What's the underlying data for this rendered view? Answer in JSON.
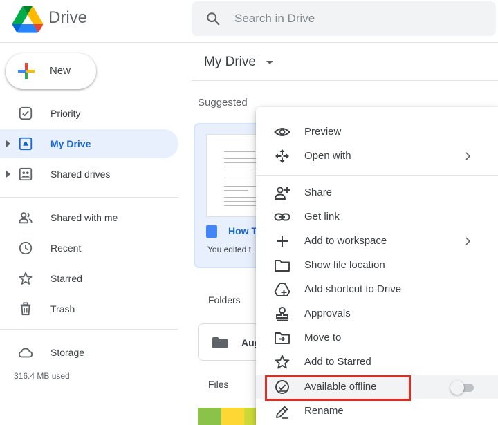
{
  "app": {
    "name": "Drive"
  },
  "search": {
    "placeholder": "Search in Drive"
  },
  "sidebar": {
    "new_label": "New",
    "items": [
      {
        "label": "Priority"
      },
      {
        "label": "My Drive"
      },
      {
        "label": "Shared drives"
      },
      {
        "label": "Shared with me"
      },
      {
        "label": "Recent"
      },
      {
        "label": "Starred"
      },
      {
        "label": "Trash"
      },
      {
        "label": "Storage"
      }
    ],
    "storage_used": "316.4 MB used"
  },
  "main": {
    "title": "My Drive",
    "suggested_label": "Suggested",
    "suggested_file": {
      "name": "How T",
      "subtitle": "You edited t"
    },
    "folders_label": "Folders",
    "folder": {
      "name": "Aug"
    },
    "files_label": "Files"
  },
  "context_menu": {
    "items": [
      {
        "label": "Preview"
      },
      {
        "label": "Open with"
      },
      {
        "label": "Share"
      },
      {
        "label": "Get link"
      },
      {
        "label": "Add to workspace"
      },
      {
        "label": "Show file location"
      },
      {
        "label": "Add shortcut to Drive"
      },
      {
        "label": "Approvals"
      },
      {
        "label": "Move to"
      },
      {
        "label": "Add to Starred"
      },
      {
        "label": "Available offline",
        "toggle_on": false
      },
      {
        "label": "Rename"
      }
    ]
  },
  "colors": {
    "accent": "#1967d2",
    "active_bg": "#e8f0fe",
    "highlight": "#d93025",
    "text": "#3c4043",
    "icon": "#5f6368"
  }
}
